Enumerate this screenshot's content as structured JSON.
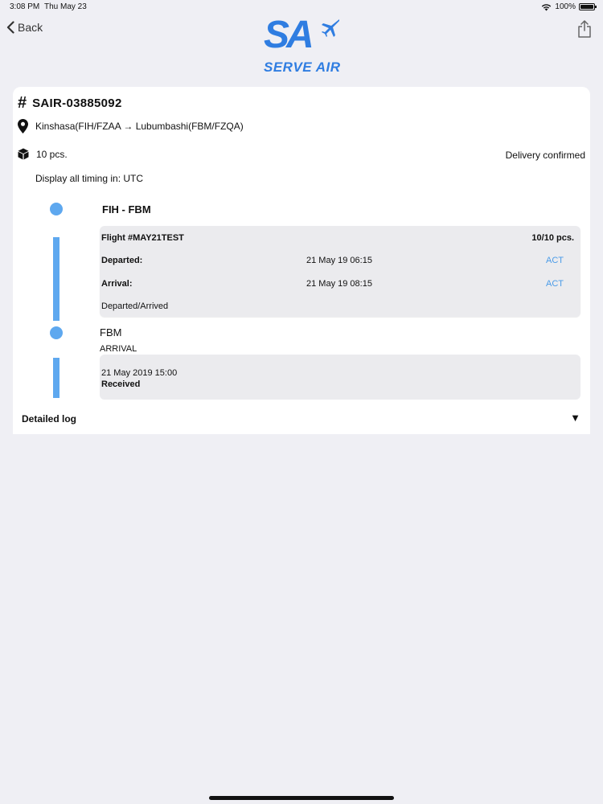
{
  "status_bar": {
    "time": "3:08 PM",
    "date": "Thu May 23",
    "battery": "100%"
  },
  "nav": {
    "back_label": "Back"
  },
  "logo": {
    "mark": "SA",
    "text": "SERVE AIR"
  },
  "shipment": {
    "awb_prefix": "#",
    "awb_number": "SAIR-03885092",
    "route": "Kinshasa(FIH/FZAA → Lubumbashi(FBM/FZQA)",
    "pieces": "10 pcs.",
    "delivery_status": "Delivery confirmed",
    "timing_note": "Display all timing in: UTC"
  },
  "segment": {
    "title": "FIH - FBM",
    "flight": "Flight #MAY21TEST",
    "pieces": "10/10 pcs.",
    "departed_label": "Departed:",
    "departed_time": "21 May 19 06:15",
    "departed_flag": "ACT",
    "arrival_label": "Arrival:",
    "arrival_time": "21 May 19 08:15",
    "arrival_flag": "ACT",
    "status": "Departed/Arrived"
  },
  "arrival_event": {
    "station": "FBM",
    "type": "ARRIVAL",
    "date": "21 May 2019 15:00",
    "status": "Received"
  },
  "detailed_log": {
    "label": "Detailed log",
    "toggle": "▼"
  },
  "colors": {
    "accent": "#5ea8ef",
    "brand": "#2f7de1",
    "act": "#4a9be8"
  }
}
